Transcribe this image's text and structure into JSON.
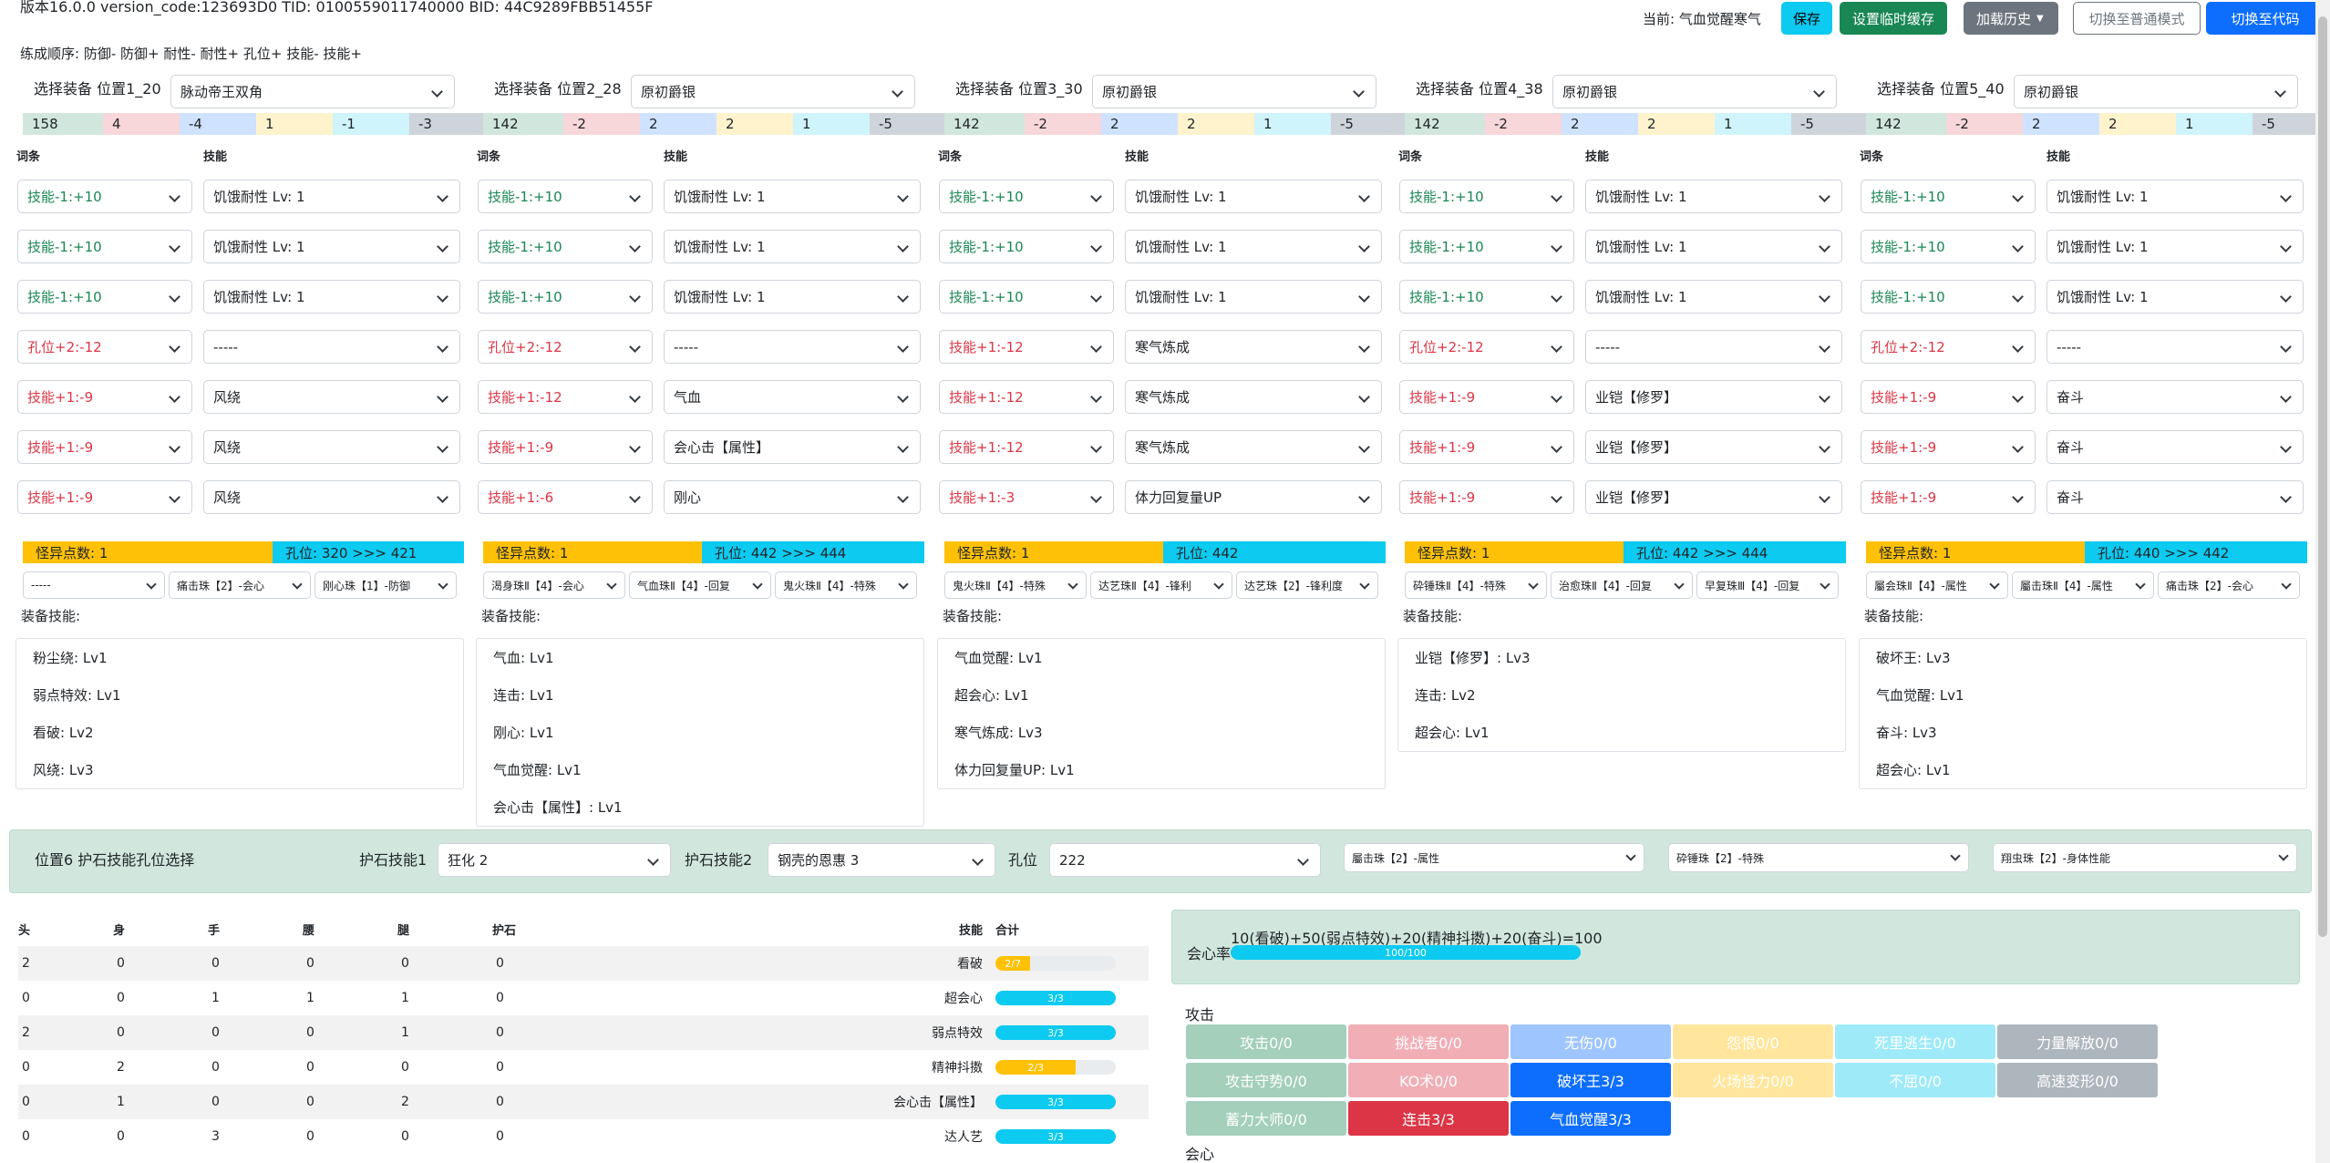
{
  "header": {
    "version_line": "版本16.0.0 version_code:123693D0 TID: 0100559011740000 BID: 44C9289FBB51455F",
    "order_line": "练成顺序: 防御- 防御+ 耐性- 耐性+ 孔位+ 技能- 技能+"
  },
  "toolbar": {
    "current": "当前: 气血觉醒寒气",
    "save": "保存",
    "temp_cache": "设置临时缓存",
    "load_history": "加载历史",
    "normal_mode": "切换至普通模式",
    "code_mode": "切换至代码"
  },
  "columns_labels": {
    "affix": "词条",
    "skill": "技能",
    "equip_skills": "装备技能:"
  },
  "columns": [
    {
      "label": "选择装备 位置1_20",
      "equip": "脉动帝王双角",
      "attrs": [
        "158",
        "4",
        "-4",
        "1",
        "-1",
        "-3"
      ],
      "rows": [
        {
          "a": "技能-1:+10",
          "ac": "green",
          "s": "饥饿耐性 Lv: 1"
        },
        {
          "a": "技能-1:+10",
          "ac": "green",
          "s": "饥饿耐性 Lv: 1"
        },
        {
          "a": "技能-1:+10",
          "ac": "green",
          "s": "饥饿耐性 Lv: 1"
        },
        {
          "a": "孔位+2:-12",
          "ac": "red",
          "s": "-----"
        },
        {
          "a": "技能+1:-9",
          "ac": "red",
          "s": "风绕"
        },
        {
          "a": "技能+1:-9",
          "ac": "red",
          "s": "风绕"
        },
        {
          "a": "技能+1:-9",
          "ac": "red",
          "s": "风绕"
        }
      ],
      "odd": "怪异点数: 1",
      "slots": "孔位: 320 >>> 421",
      "jewels": [
        "-----",
        "痛击珠【2】-会心",
        "刚心珠【1】-防御"
      ],
      "skills": [
        "粉尘绕: Lv1",
        "弱点特效: Lv1",
        "看破: Lv2",
        "风绕: Lv3"
      ]
    },
    {
      "label": "选择装备 位置2_28",
      "equip": "原初爵银",
      "attrs": [
        "142",
        "-2",
        "2",
        "2",
        "1",
        "-5"
      ],
      "rows": [
        {
          "a": "技能-1:+10",
          "ac": "green",
          "s": "饥饿耐性 Lv: 1"
        },
        {
          "a": "技能-1:+10",
          "ac": "green",
          "s": "饥饿耐性 Lv: 1"
        },
        {
          "a": "技能-1:+10",
          "ac": "green",
          "s": "饥饿耐性 Lv: 1"
        },
        {
          "a": "孔位+2:-12",
          "ac": "red",
          "s": "-----"
        },
        {
          "a": "技能+1:-12",
          "ac": "red",
          "s": "气血"
        },
        {
          "a": "技能+1:-9",
          "ac": "red",
          "s": "会心击【属性】"
        },
        {
          "a": "技能+1:-6",
          "ac": "red",
          "s": "刚心"
        }
      ],
      "odd": "怪异点数: 1",
      "slots": "孔位: 442 >>> 444",
      "jewels": [
        "渴身珠Ⅱ【4】-会心",
        "气血珠Ⅱ【4】-回复",
        "鬼火珠Ⅱ【4】-特殊"
      ],
      "skills": [
        "气血: Lv1",
        "连击: Lv1",
        "刚心: Lv1",
        "气血觉醒: Lv1",
        "会心击【属性】: Lv1"
      ]
    },
    {
      "label": "选择装备 位置3_30",
      "equip": "原初爵银",
      "attrs": [
        "142",
        "-2",
        "2",
        "2",
        "1",
        "-5"
      ],
      "rows": [
        {
          "a": "技能-1:+10",
          "ac": "green",
          "s": "饥饿耐性 Lv: 1"
        },
        {
          "a": "技能-1:+10",
          "ac": "green",
          "s": "饥饿耐性 Lv: 1"
        },
        {
          "a": "技能-1:+10",
          "ac": "green",
          "s": "饥饿耐性 Lv: 1"
        },
        {
          "a": "技能+1:-12",
          "ac": "red",
          "s": "寒气炼成"
        },
        {
          "a": "技能+1:-12",
          "ac": "red",
          "s": "寒气炼成"
        },
        {
          "a": "技能+1:-12",
          "ac": "red",
          "s": "寒气炼成"
        },
        {
          "a": "技能+1:-3",
          "ac": "red",
          "s": "体力回复量UP"
        }
      ],
      "odd": "怪异点数: 1",
      "slots": "孔位: 442",
      "jewels": [
        "鬼火珠Ⅱ【4】-特殊",
        "达艺珠Ⅱ【4】-锋利",
        "达艺珠【2】-锋利度"
      ],
      "skills": [
        "气血觉醒: Lv1",
        "超会心: Lv1",
        "寒气炼成: Lv3",
        "体力回复量UP: Lv1"
      ]
    },
    {
      "label": "选择装备 位置4_38",
      "equip": "原初爵银",
      "attrs": [
        "142",
        "-2",
        "2",
        "2",
        "1",
        "-5"
      ],
      "rows": [
        {
          "a": "技能-1:+10",
          "ac": "green",
          "s": "饥饿耐性 Lv: 1"
        },
        {
          "a": "技能-1:+10",
          "ac": "green",
          "s": "饥饿耐性 Lv: 1"
        },
        {
          "a": "技能-1:+10",
          "ac": "green",
          "s": "饥饿耐性 Lv: 1"
        },
        {
          "a": "孔位+2:-12",
          "ac": "red",
          "s": "-----"
        },
        {
          "a": "技能+1:-9",
          "ac": "red",
          "s": "业铠【修罗】"
        },
        {
          "a": "技能+1:-9",
          "ac": "red",
          "s": "业铠【修罗】"
        },
        {
          "a": "技能+1:-9",
          "ac": "red",
          "s": "业铠【修罗】"
        }
      ],
      "odd": "怪异点数: 1",
      "slots": "孔位: 442 >>> 444",
      "jewels": [
        "砕锤珠Ⅱ【4】-特殊",
        "治愈珠Ⅱ【4】-回复",
        "早复珠Ⅲ【4】-回复"
      ],
      "skills": [
        "业铠【修罗】: Lv3",
        "连击: Lv2",
        "超会心: Lv1"
      ]
    },
    {
      "label": "选择装备 位置5_40",
      "equip": "原初爵银",
      "attrs": [
        "142",
        "-2",
        "2",
        "2",
        "1",
        "-5"
      ],
      "rows": [
        {
          "a": "技能-1:+10",
          "ac": "green",
          "s": "饥饿耐性 Lv: 1"
        },
        {
          "a": "技能-1:+10",
          "ac": "green",
          "s": "饥饿耐性 Lv: 1"
        },
        {
          "a": "技能-1:+10",
          "ac": "green",
          "s": "饥饿耐性 Lv: 1"
        },
        {
          "a": "孔位+2:-12",
          "ac": "red",
          "s": "-----"
        },
        {
          "a": "技能+1:-9",
          "ac": "red",
          "s": "奋斗"
        },
        {
          "a": "技能+1:-9",
          "ac": "red",
          "s": "奋斗"
        },
        {
          "a": "技能+1:-9",
          "ac": "red",
          "s": "奋斗"
        }
      ],
      "odd": "怪异点数: 1",
      "slots": "孔位: 440 >>> 442",
      "jewels": [
        "屬会珠Ⅱ【4】-属性",
        "屬击珠Ⅱ【4】-属性",
        "痛击珠【2】-会心"
      ],
      "skills": [
        "破坏王: Lv3",
        "气血觉醒: Lv1",
        "奋斗: Lv3",
        "超会心: Lv1"
      ]
    }
  ],
  "talisman": {
    "title": "位置6 护石技能孔位选择",
    "skill1_label": "护石技能1",
    "skill1": "狂化 2",
    "skill2_label": "护石技能2",
    "skill2": "钢壳的恩惠 3",
    "slot_label": "孔位",
    "slot": "222",
    "jewels": [
      "屬击珠【2】-属性",
      "砕锤珠【2】-特殊",
      "翔虫珠【2】-身体性能"
    ]
  },
  "table": {
    "headers": [
      "头",
      "身",
      "手",
      "腰",
      "腿",
      "护石",
      "技能",
      "合计"
    ],
    "rows": [
      {
        "v": [
          "2",
          "0",
          "0",
          "0",
          "0",
          "0"
        ],
        "skill": "看破",
        "total": "2/7",
        "pct": 29,
        "color": "#ffc107"
      },
      {
        "v": [
          "0",
          "0",
          "1",
          "1",
          "1",
          "0"
        ],
        "skill": "超会心",
        "total": "3/3",
        "pct": 100,
        "color": "#0dcaf0"
      },
      {
        "v": [
          "2",
          "0",
          "0",
          "0",
          "1",
          "0"
        ],
        "skill": "弱点特效",
        "total": "3/3",
        "pct": 100,
        "color": "#0dcaf0"
      },
      {
        "v": [
          "0",
          "2",
          "0",
          "0",
          "0",
          "0"
        ],
        "skill": "精神抖擞",
        "total": "2/3",
        "pct": 67,
        "color": "#ffc107"
      },
      {
        "v": [
          "0",
          "1",
          "0",
          "0",
          "2",
          "0"
        ],
        "skill": "会心击【属性】",
        "total": "3/3",
        "pct": 100,
        "color": "#0dcaf0"
      },
      {
        "v": [
          "0",
          "0",
          "3",
          "0",
          "0",
          "0"
        ],
        "skill": "达人艺",
        "total": "3/3",
        "pct": 100,
        "color": "#0dcaf0"
      }
    ]
  },
  "crit": {
    "label": "会心率",
    "formula": "10(看破)+50(弱点特效)+20(精神抖擞)+20(奋斗)=100",
    "bar_text": "100/100",
    "pct": 100
  },
  "attack": {
    "title": "攻击",
    "skills": [
      [
        "攻击0/0",
        "挑战者0/0",
        "无伤0/0",
        "怨恨0/0",
        "死里逃生0/0",
        "力量解放0/0"
      ],
      [
        "攻击守势0/0",
        "KO术0/0",
        "破坏王3/3",
        "火场怪力0/0",
        "不屈0/0",
        "高速变形0/0"
      ],
      [
        "蓄力大师0/0",
        "连击3/3",
        "气血觉醒3/3"
      ]
    ]
  },
  "bottom_label": "会心"
}
